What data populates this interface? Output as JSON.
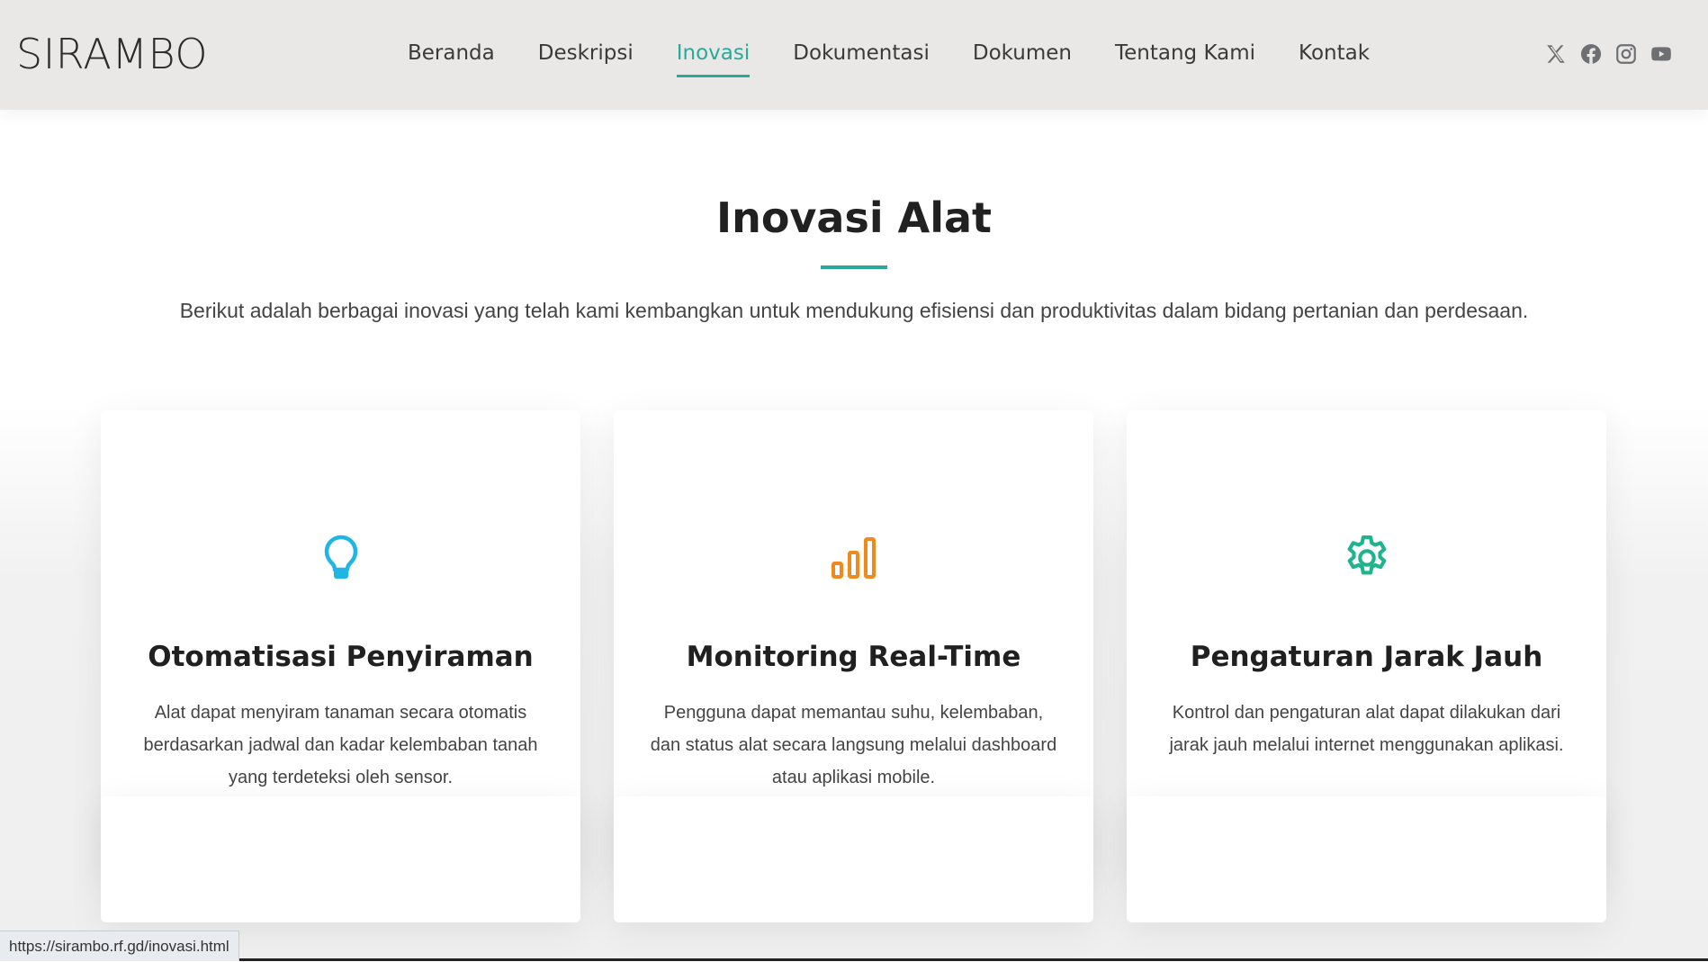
{
  "header": {
    "logo": "SIRAMBO",
    "nav": [
      {
        "label": "Beranda",
        "active": false
      },
      {
        "label": "Deskripsi",
        "active": false
      },
      {
        "label": "Inovasi",
        "active": true
      },
      {
        "label": "Dokumentasi",
        "active": false
      },
      {
        "label": "Dokumen",
        "active": false
      },
      {
        "label": "Tentang Kami",
        "active": false
      },
      {
        "label": "Kontak",
        "active": false
      }
    ],
    "socials": [
      "x-icon",
      "facebook-icon",
      "instagram-icon",
      "youtube-icon"
    ]
  },
  "section": {
    "title": "Inovasi Alat",
    "subtitle": "Berikut adalah berbagai inovasi yang telah kami kembangkan untuk mendukung efisiensi dan produktivitas dalam bidang pertanian dan perdesaan."
  },
  "cards": [
    {
      "icon": "lightbulb-icon",
      "icon_color": "#1fb6e6",
      "title": "Otomatisasi Penyiraman",
      "desc": "Alat dapat menyiram tanaman secara otomatis berdasarkan jadwal dan kadar kelembaban tanah yang terdeteksi oleh sensor."
    },
    {
      "icon": "bar-chart-icon",
      "icon_color": "#f08a1d",
      "title": "Monitoring Real-Time",
      "desc": "Pengguna dapat memantau suhu, kelembaban, dan status alat secara langsung melalui dashboard atau aplikasi mobile."
    },
    {
      "icon": "gear-icon",
      "icon_color": "#1fb38e",
      "title": "Pengaturan Jarak Jauh",
      "desc": "Kontrol dan pengaturan alat dapat dilakukan dari jarak jauh melalui internet menggunakan aplikasi."
    }
  ],
  "status_bar": {
    "url": "https://sirambo.rf.gd/inovasi.html"
  },
  "colors": {
    "accent": "#2aa99a",
    "header_bg": "#e9e8e6"
  }
}
